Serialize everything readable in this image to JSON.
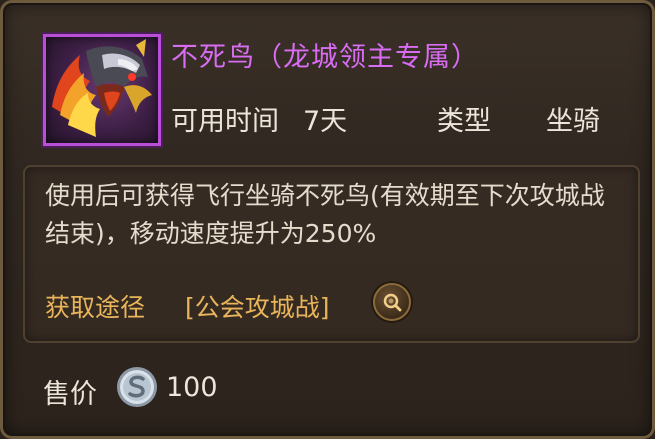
{
  "item": {
    "name": "不死鸟（龙城领主专属）",
    "name_color": "#d86cf2",
    "rarity_frame_color": "#b84fd6",
    "icon": "phoenix-mount-icon"
  },
  "stats": {
    "duration_label": "可用时间",
    "duration_value": "7天",
    "type_label": "类型",
    "type_value": "坐骑"
  },
  "description": {
    "text": "使用后可获得飞行坐骑不死鸟(有效期至下次攻城战结束)，移动速度提升为250%",
    "source_label": "获取途径",
    "source_value": "[公会攻城战]",
    "source_color": "#e9b55a",
    "search_icon": "magnifier-icon"
  },
  "price": {
    "label": "售价",
    "currency_icon": "silver-coin-icon",
    "value": "100"
  }
}
